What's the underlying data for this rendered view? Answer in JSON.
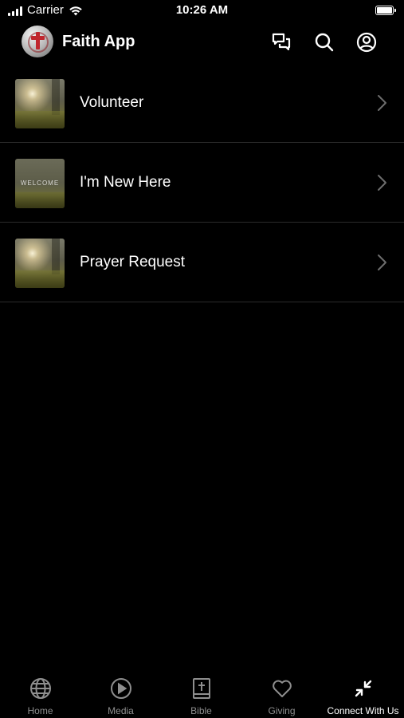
{
  "status_bar": {
    "carrier": "Carrier",
    "time": "10:26 AM"
  },
  "header": {
    "title": "Faith App",
    "icons": [
      "chat-icon",
      "search-icon",
      "account-icon"
    ]
  },
  "list": {
    "items": [
      {
        "label": "Volunteer",
        "thumbnail": "sunlit-field"
      },
      {
        "label": "I'm New Here",
        "thumbnail": "welcome",
        "thumbnail_text": "WELCOME"
      },
      {
        "label": "Prayer Request",
        "thumbnail": "sunlit-field"
      }
    ]
  },
  "tab_bar": {
    "tabs": [
      {
        "label": "Home",
        "icon": "globe-icon",
        "active": false
      },
      {
        "label": "Media",
        "icon": "play-icon",
        "active": false
      },
      {
        "label": "Bible",
        "icon": "bible-icon",
        "active": false
      },
      {
        "label": "Giving",
        "icon": "heart-icon",
        "active": false
      },
      {
        "label": "Connect With Us",
        "icon": "compress-arrows-icon",
        "active": true
      }
    ]
  },
  "colors": {
    "background": "#000000",
    "text": "#ffffff",
    "inactive_tab": "#8e8e8e",
    "divider": "#2b2b2b",
    "logo_cross": "#c0262d"
  }
}
